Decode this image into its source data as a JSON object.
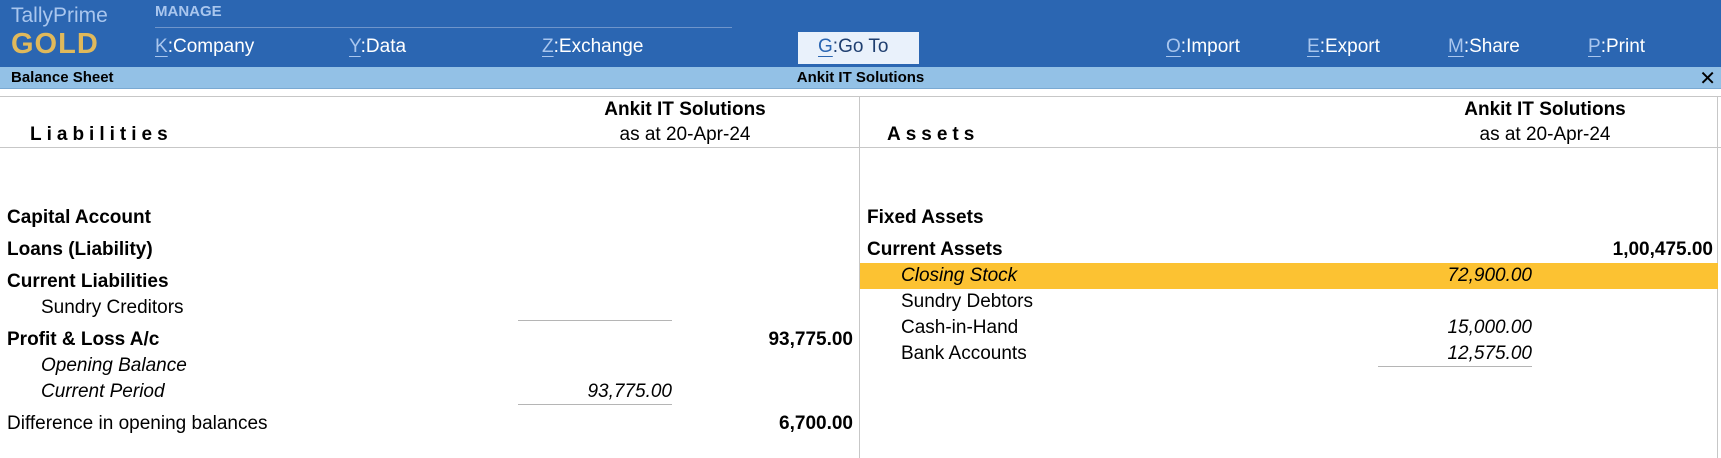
{
  "app": {
    "name": "TallyPrime",
    "edition": "GOLD"
  },
  "topbar": {
    "section_label": "MANAGE",
    "menu": [
      {
        "key": "K",
        "label": "Company"
      },
      {
        "key": "Y",
        "label": "Data"
      },
      {
        "key": "Z",
        "label": "Exchange"
      },
      {
        "key": "G",
        "label": "Go To"
      },
      {
        "key": "O",
        "label": "Import"
      },
      {
        "key": "E",
        "label": "Export"
      },
      {
        "key": "M",
        "label": "Share"
      },
      {
        "key": "P",
        "label": "Print"
      }
    ]
  },
  "report": {
    "title": "Balance Sheet",
    "company": "Ankit IT Solutions",
    "close_glyph": "✕"
  },
  "liabilities": {
    "heading": "Liabilities",
    "company": "Ankit IT Solutions",
    "date": "as at 20-Apr-24",
    "rows": [
      {
        "label": "Capital Account",
        "amount": ""
      },
      {
        "label": "Loans (Liability)",
        "amount": ""
      },
      {
        "label": "Current Liabilities",
        "amount": ""
      },
      {
        "label": "Sundry Creditors",
        "amount": ""
      },
      {
        "label": "Profit & Loss A/c",
        "amount": "93,775.00"
      },
      {
        "label": "Opening Balance",
        "amount": ""
      },
      {
        "label": "Current Period",
        "amount": "93,775.00"
      },
      {
        "label": "Difference in opening balances",
        "amount": "6,700.00"
      }
    ]
  },
  "assets": {
    "heading": "Assets",
    "company": "Ankit IT Solutions",
    "date": "as at 20-Apr-24",
    "rows": [
      {
        "label": "Fixed Assets",
        "amount": ""
      },
      {
        "label": "Current Assets",
        "amount": "1,00,475.00"
      },
      {
        "label": "Closing Stock",
        "amount": "72,900.00"
      },
      {
        "label": "Sundry Debtors",
        "amount": ""
      },
      {
        "label": "Cash-in-Hand",
        "amount": "15,000.00"
      },
      {
        "label": "Bank Accounts",
        "amount": "12,575.00"
      }
    ]
  },
  "colors": {
    "topbar": "#2b66b2",
    "subbar": "#93c1e6",
    "highlight": "#fcc232",
    "edition": "#e0b95b"
  }
}
